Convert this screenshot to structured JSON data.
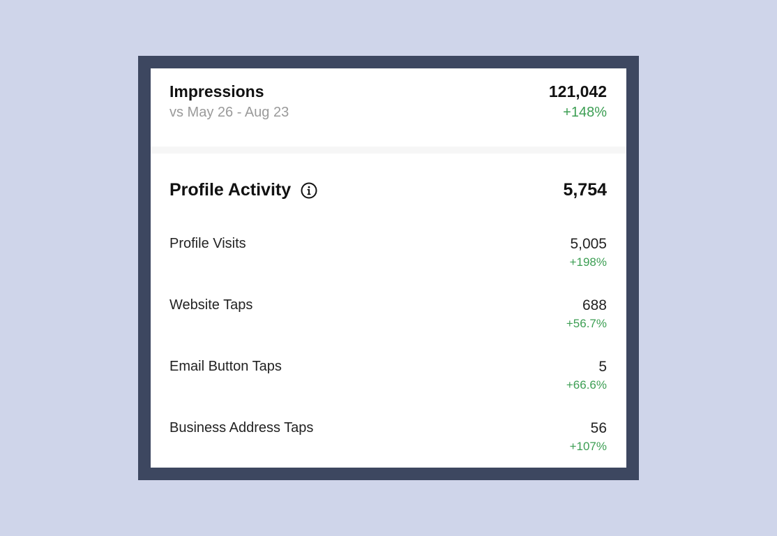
{
  "impressions": {
    "title": "Impressions",
    "comparison": "vs May 26 - Aug 23",
    "value": "121,042",
    "change": "+148%"
  },
  "profile_activity": {
    "title": "Profile Activity",
    "value": "5,754",
    "info_icon": "info-circle-icon",
    "metrics": [
      {
        "label": "Profile Visits",
        "value": "5,005",
        "change": "+198%"
      },
      {
        "label": "Website Taps",
        "value": "688",
        "change": "+56.7%"
      },
      {
        "label": "Email Button Taps",
        "value": "5",
        "change": "+66.6%"
      },
      {
        "label": "Business Address Taps",
        "value": "56",
        "change": "+107%"
      }
    ]
  },
  "colors": {
    "background": "#cfd5ea",
    "frame": "#3d4760",
    "panel": "#ffffff",
    "positive": "#3c9e53",
    "muted": "#9a9a9a"
  }
}
